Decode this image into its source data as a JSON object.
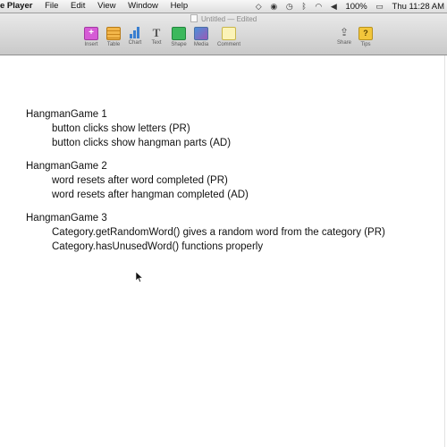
{
  "menubar": {
    "app_name": "e Player",
    "menus": [
      "File",
      "Edit",
      "View",
      "Window",
      "Help"
    ],
    "status": {
      "battery": "100%",
      "clock": "Thu 11:28 AM"
    }
  },
  "window": {
    "title": "Untitled",
    "status": "— Edited"
  },
  "toolbar": {
    "tools": [
      {
        "label": "Insert",
        "icon": "insert-icon"
      },
      {
        "label": "Table",
        "icon": "table-icon"
      },
      {
        "label": "Chart",
        "icon": "chart-icon"
      },
      {
        "label": "Text",
        "icon": "text-icon"
      },
      {
        "label": "Shape",
        "icon": "shape-icon"
      },
      {
        "label": "Media",
        "icon": "media-icon"
      },
      {
        "label": "Comment",
        "icon": "comment-icon"
      },
      {
        "label": "Share",
        "icon": "share-icon"
      },
      {
        "label": "Tips",
        "icon": "tips-icon"
      }
    ]
  },
  "document": {
    "sections": [
      {
        "heading": "HangmanGame 1",
        "items": [
          "button clicks show letters (PR)",
          "button clicks show hangman parts (AD)"
        ]
      },
      {
        "heading": "HangmanGame 2",
        "items": [
          "word resets after word completed (PR)",
          "word resets after hangman completed (AD)"
        ]
      },
      {
        "heading": "HangmanGame 3",
        "items": [
          "Category.getRandomWord() gives a random word from the category (PR)",
          "Category.hasUnusedWord() functions properly"
        ]
      }
    ]
  }
}
